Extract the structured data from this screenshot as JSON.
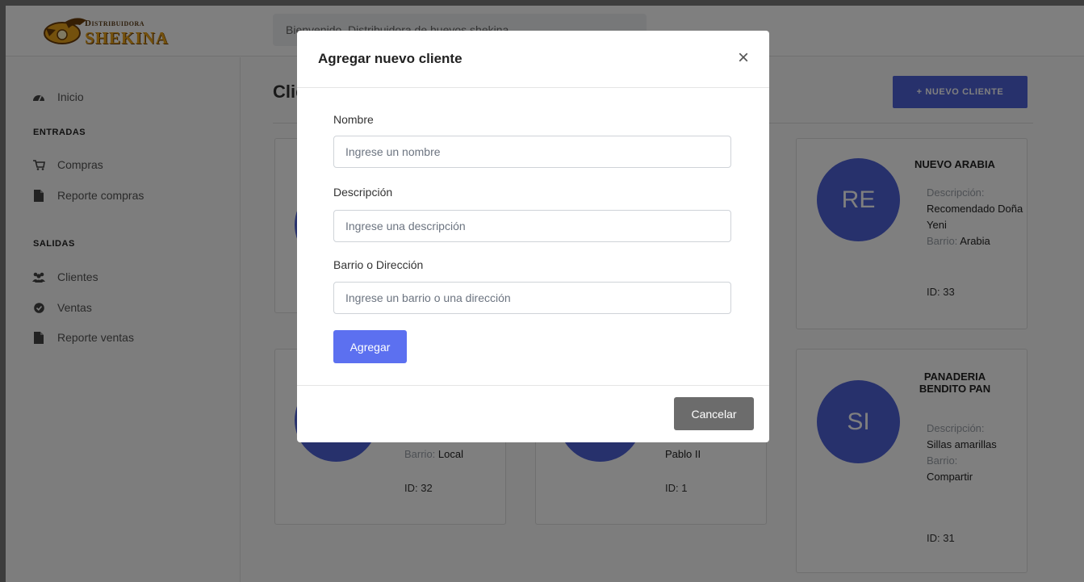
{
  "logo": {
    "sup": "Distribuidora",
    "main": "SHEKINA"
  },
  "header": {
    "welcome": "Bienvenido, Distribuidora de huevos shekina"
  },
  "sidebar": {
    "inicio": "Inicio",
    "entradas_head": "ENTRADAS",
    "compras": "Compras",
    "reporte_compras": "Reporte compras",
    "salidas_head": "SALIDAS",
    "clientes": "Clientes",
    "ventas": "Ventas",
    "reporte_ventas": "Reporte ventas"
  },
  "main": {
    "title": "Clientes",
    "new_button": "+ NUEVO CLIENTE"
  },
  "cards": [
    {
      "initials": "RE",
      "name": "NUEVO ARABIA",
      "desc_label": "Descripción:",
      "desc": "Recomendado Doña Yeni",
      "barrio_label": "Barrio:",
      "barrio": "Arabia",
      "id": "ID: 33"
    },
    {
      "barrio_label": "Barrio:",
      "barrio": "Local",
      "id": "ID: 32"
    },
    {
      "barrio": "Pablo II",
      "id": "ID: 1"
    },
    {
      "initials": "SI",
      "name": "PANADERIA BENDITO PAN",
      "desc_label": "Descripción:",
      "desc": "Sillas amarillas",
      "barrio_label": "Barrio:",
      "barrio": "Compartir",
      "id": "ID: 31"
    }
  ],
  "modal": {
    "title": "Agregar nuevo cliente",
    "close": "×",
    "nombre_label": "Nombre",
    "nombre_placeholder": "Ingrese un nombre",
    "descripcion_label": "Descripción",
    "descripcion_placeholder": "Ingrese una descripción",
    "barrio_label": "Barrio o Dirección",
    "barrio_placeholder": "Ingrese un barrio o una dirección",
    "add_button": "Agregar",
    "cancel_button": "Cancelar"
  },
  "colors": {
    "primary": "#4f62d8",
    "button_add": "#5c70f0",
    "button_cancel": "#6c6c6c"
  }
}
